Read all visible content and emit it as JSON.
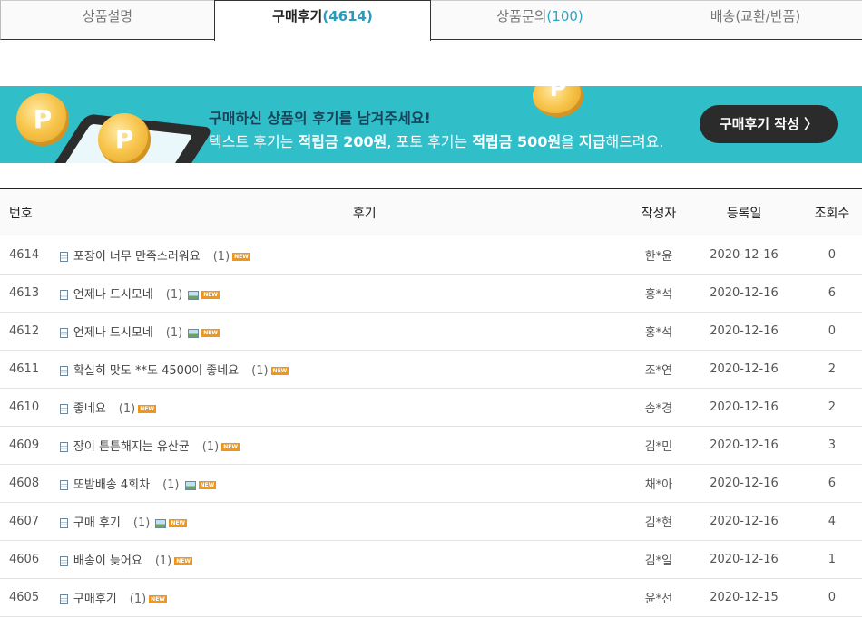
{
  "tabs": [
    {
      "label": "상품설명",
      "count": ""
    },
    {
      "label": "구매후기",
      "count": "(4614)"
    },
    {
      "label": "상품문의",
      "count": "(100)"
    },
    {
      "label": "배송(교환/반품)",
      "count": ""
    }
  ],
  "banner": {
    "line1": "구매하신 상품의 후기를 남겨주세요!",
    "line2_a": "텍스트 후기는 ",
    "line2_b": "적립금 200원",
    "line2_c": ", 포토 후기는 ",
    "line2_d": "적립금 500원",
    "line2_e": "을 ",
    "line2_f": "지급",
    "line2_g": "해드려요.",
    "coin_letter": "P",
    "button_label": "구매후기 작성 〉",
    "bg_color": "#30bfc9"
  },
  "table": {
    "headers": {
      "no": "번호",
      "title": "후기",
      "author": "작성자",
      "date": "등록일",
      "views": "조회수"
    },
    "rows": [
      {
        "no": "4614",
        "title": "포장이 너무 만족스러워요",
        "comments": "(1)",
        "has_image": false,
        "new": "NEW",
        "author": "한*윤",
        "date": "2020-12-16",
        "views": "0"
      },
      {
        "no": "4613",
        "title": "언제나 드시모네",
        "comments": "(1)",
        "has_image": true,
        "new": "NEW",
        "author": "홍*석",
        "date": "2020-12-16",
        "views": "6"
      },
      {
        "no": "4612",
        "title": "언제나 드시모네",
        "comments": "(1)",
        "has_image": true,
        "new": "NEW",
        "author": "홍*석",
        "date": "2020-12-16",
        "views": "0"
      },
      {
        "no": "4611",
        "title": "확실히 맛도 **도 4500이 좋네요",
        "comments": "(1)",
        "has_image": false,
        "new": "NEW",
        "author": "조*연",
        "date": "2020-12-16",
        "views": "2"
      },
      {
        "no": "4610",
        "title": "좋네요",
        "comments": "(1)",
        "has_image": false,
        "new": "NEW",
        "author": "송*경",
        "date": "2020-12-16",
        "views": "2"
      },
      {
        "no": "4609",
        "title": "장이 튼튼해지는 유산균",
        "comments": "(1)",
        "has_image": false,
        "new": "NEW",
        "author": "김*민",
        "date": "2020-12-16",
        "views": "3"
      },
      {
        "no": "4608",
        "title": "또받배송 4회차",
        "comments": "(1)",
        "has_image": true,
        "new": "NEW",
        "author": "채*아",
        "date": "2020-12-16",
        "views": "6"
      },
      {
        "no": "4607",
        "title": "구매 후기",
        "comments": "(1)",
        "has_image": true,
        "new": "NEW",
        "author": "김*현",
        "date": "2020-12-16",
        "views": "4"
      },
      {
        "no": "4606",
        "title": "배송이 늦어요",
        "comments": "(1)",
        "has_image": false,
        "new": "NEW",
        "author": "김*일",
        "date": "2020-12-16",
        "views": "1"
      },
      {
        "no": "4605",
        "title": "구매후기",
        "comments": "(1)",
        "has_image": false,
        "new": "NEW",
        "author": "윤*선",
        "date": "2020-12-15",
        "views": "0"
      }
    ]
  }
}
